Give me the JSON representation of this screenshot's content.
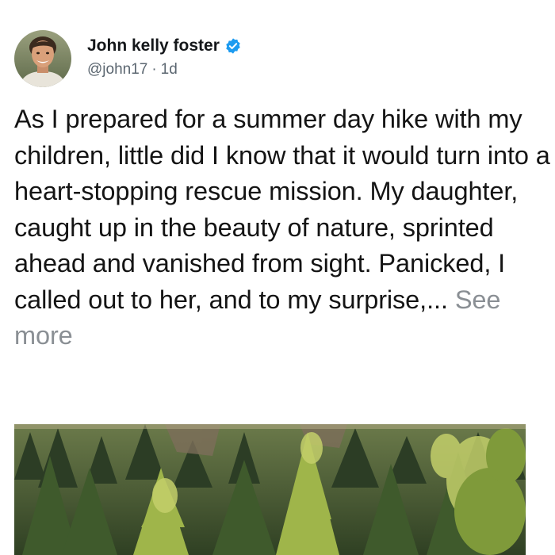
{
  "post": {
    "author": {
      "name": "John kelly foster",
      "handle": "@john17",
      "separator": "·",
      "time": "1d",
      "avatar_icon": "profile-photo",
      "verified_icon": "verified-badge-icon",
      "verified_color": "#1d9bf0"
    },
    "text": "As I prepared for a summer day hike with my children, little did I know that it would turn into a heart-stopping rescue mission. My daughter, caught up in the beauty of nature, sprinted ahead and vanished from sight. Panicked, I called out to her, and to my surprise,...",
    "see_more_label": "See more",
    "image": {
      "subject": "forest-photo"
    }
  }
}
